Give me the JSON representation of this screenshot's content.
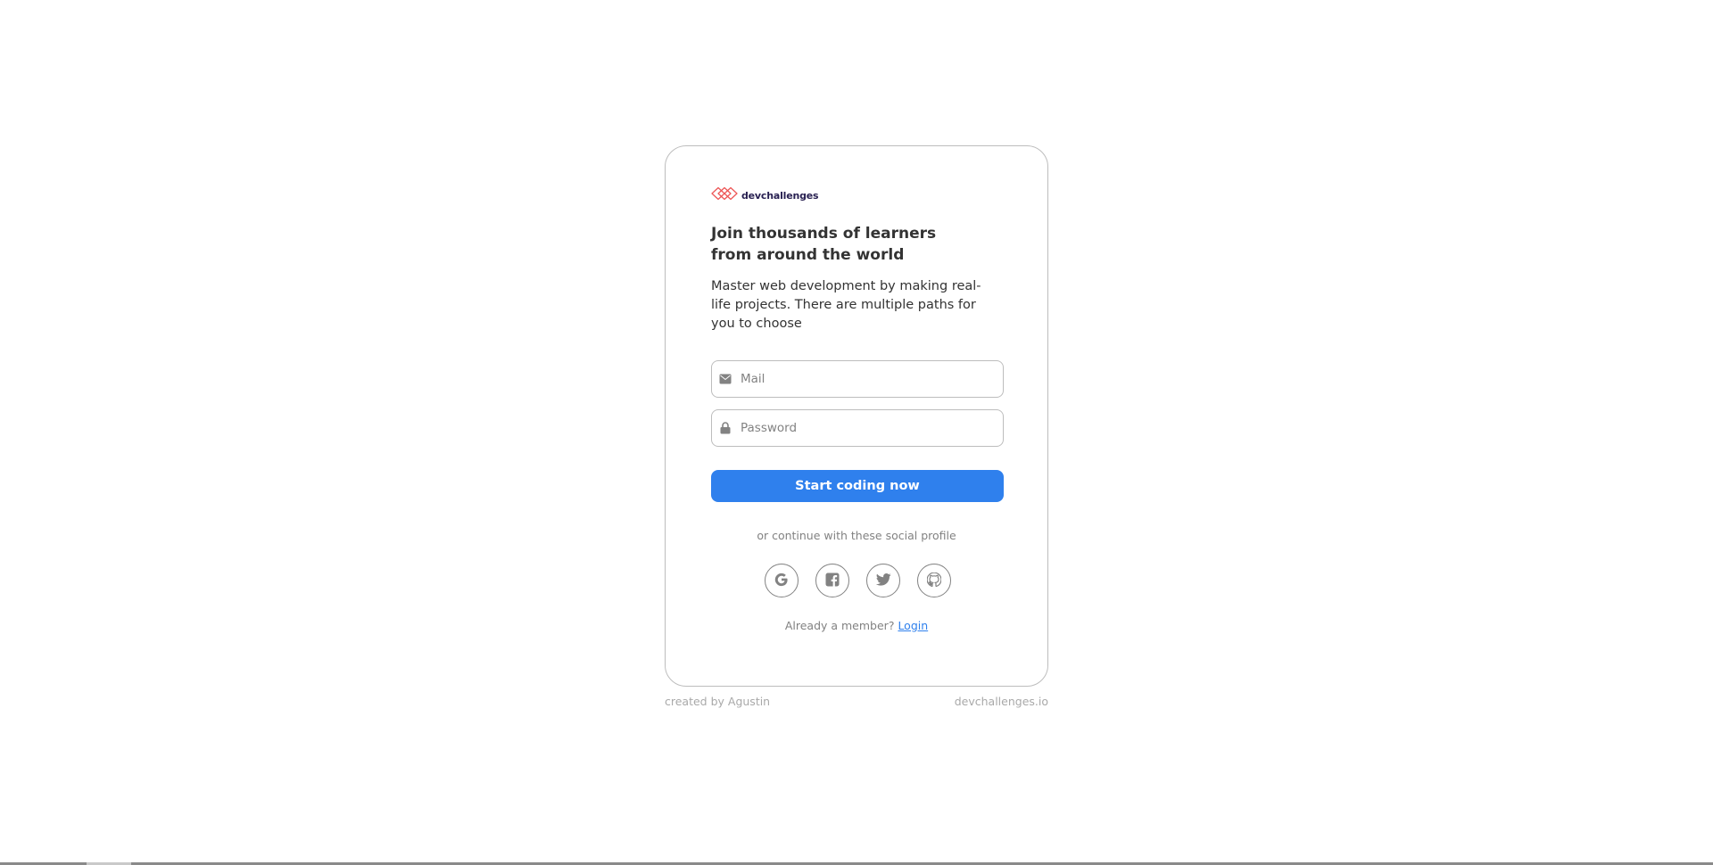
{
  "logo": {
    "brand": "devchallenges",
    "icon": "devchallenges-logo-icon",
    "icon_color": "#ED5757",
    "text_color": "#282051"
  },
  "hero": {
    "title": "Join thousands of learners from around the world",
    "description": "Master web development by making real-life projects. There are multiple paths for you to choose"
  },
  "form": {
    "email": {
      "placeholder": "Mail",
      "value": "",
      "icon": "mail-icon"
    },
    "password": {
      "placeholder": "Password",
      "value": "",
      "icon": "lock-icon"
    },
    "submit_label": "Start coding now"
  },
  "social": {
    "prompt": "or continue with these social profile",
    "providers": [
      {
        "name": "Google",
        "icon": "google-icon"
      },
      {
        "name": "Facebook",
        "icon": "facebook-icon"
      },
      {
        "name": "Twitter",
        "icon": "twitter-icon"
      },
      {
        "name": "GitHub",
        "icon": "github-icon"
      }
    ]
  },
  "member": {
    "question": "Already a member?",
    "link_label": "Login"
  },
  "footer": {
    "credit": "created by Agustin",
    "site": "devchallenges.io"
  },
  "colors": {
    "accent": "#2F80ED",
    "border": "#BDBDBD",
    "muted_text": "#828282"
  }
}
